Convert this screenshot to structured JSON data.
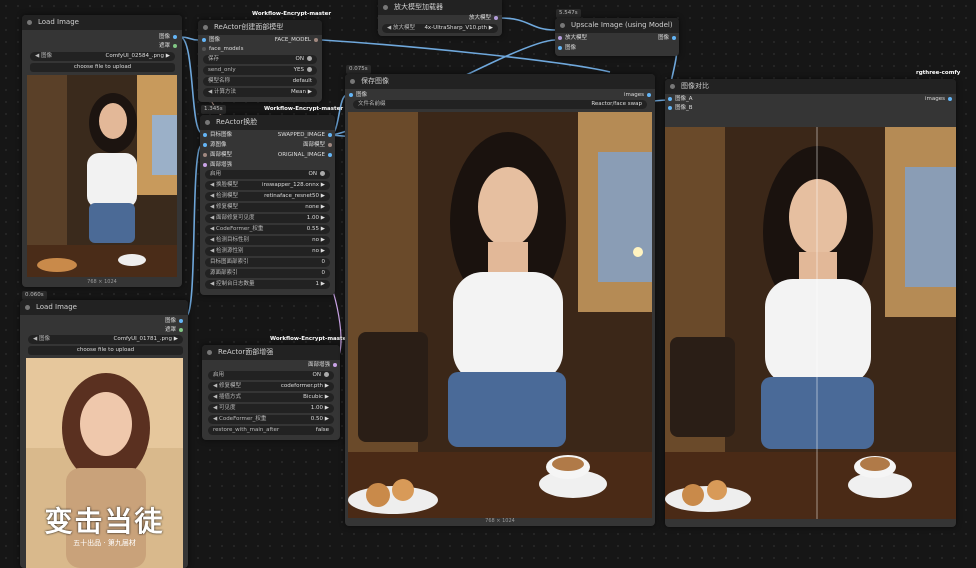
{
  "colors": {
    "image": "#64b5f6",
    "face_model": "#a1887f",
    "model": "#b39ddb",
    "link": "#6fa8dc"
  },
  "nodes": {
    "load1": {
      "title": "Load Image",
      "image_label": "图像",
      "image_value": "ComfyUI_02584_.png",
      "upload": "choose file to upload",
      "out_image": "图像",
      "out_mask": "遮罩",
      "dims": "768 × 1024"
    },
    "load2": {
      "badge": "0.060s",
      "title": "Load Image",
      "image_label": "图像",
      "image_value": "ComfyUI_01781_.png",
      "upload": "choose file to upload",
      "out_image": "图像",
      "out_mask": "遮罩",
      "art_title": "变击当徒",
      "art_sub": "五十出品 · 第九届材"
    },
    "reactor_save": {
      "tag": "Workflow-Encrypt-master",
      "title": "ReActor创建面部模型",
      "in_image": "图像",
      "out_face": "FACE_MODEL",
      "in_face_models": "face_models",
      "rows": [
        {
          "label": "保存",
          "value": "ON"
        },
        {
          "label": "send_only",
          "value": "YES"
        },
        {
          "label": "模型名称",
          "value": "default"
        },
        {
          "label": "计算方法",
          "value": "Mean"
        }
      ]
    },
    "reactor_swap": {
      "badge": "1.345s",
      "tag": "Workflow-Encrypt-master",
      "title": "ReActor换脸",
      "inputs": [
        "目标图像",
        "源图像",
        "面部模型",
        "面部增强"
      ],
      "outputs": [
        "SWAPPED_IMAGE",
        "面部模型",
        "ORIGINAL_IMAGE"
      ],
      "rows": [
        {
          "label": "启用",
          "value": "ON"
        },
        {
          "label": "换脸模型",
          "value": "inswapper_128.onnx"
        },
        {
          "label": "检测模型",
          "value": "retinaface_resnet50"
        },
        {
          "label": "修复模型",
          "value": "none"
        },
        {
          "label": "面部修复可见度",
          "value": "1.00"
        },
        {
          "label": "CodeFormer_权重",
          "value": "0.55"
        },
        {
          "label": "检测目标性别",
          "value": "no"
        },
        {
          "label": "检测源性别",
          "value": "no"
        },
        {
          "label": "目标图面部索引",
          "value": "0"
        },
        {
          "label": "源面部索引",
          "value": "0"
        },
        {
          "label": "控制台日志数量",
          "value": "1"
        }
      ]
    },
    "restore": {
      "tag": "Workflow-Encrypt-master",
      "title": "ReActor面部增强",
      "out": "面部增强",
      "rows": [
        {
          "label": "启用",
          "value": "ON"
        },
        {
          "label": "修复模型",
          "value": "codeformer.pth"
        },
        {
          "label": "插值方式",
          "value": "Bicubic"
        },
        {
          "label": "可见度",
          "value": "1.00"
        },
        {
          "label": "CodeFormer_权重",
          "value": "0.50"
        },
        {
          "label": "restore_with_main_after",
          "value": "false"
        }
      ]
    },
    "save": {
      "badge": "0.075s",
      "title": "保存图像",
      "in_image": "图像",
      "out_images": "images",
      "prefix_label": "文件名前缀",
      "prefix_value": "Reactor/face swap",
      "dims": "768 × 1024"
    },
    "upscale_loader": {
      "title": "放大模型加载器",
      "out": "放大模型",
      "model_label": "放大模型",
      "model_value": "4x-UltraSharp_V10.pth"
    },
    "upscale": {
      "badge": "5.547s",
      "title": "Upscale Image (using Model)",
      "in_model": "放大模型",
      "in_image": "图像",
      "out_image": "图像"
    },
    "compare": {
      "tag": "rgthree-comfy",
      "title": "图像对比",
      "in_a": "图像_A",
      "in_b": "图像_B",
      "out": "images"
    }
  }
}
